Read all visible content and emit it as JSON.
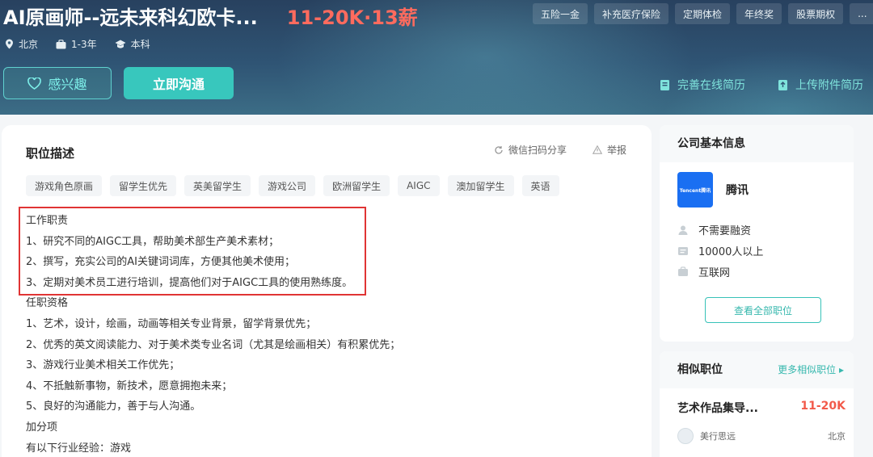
{
  "job": {
    "title": "AI原画师--远未来科幻欧卡...",
    "salary": "11-20K·13薪",
    "city": "北京",
    "experience": "1-3年",
    "education": "本科",
    "benefits": [
      "五险一金",
      "补充医疗保险",
      "定期体检",
      "年终奖",
      "股票期权",
      "..."
    ]
  },
  "actions": {
    "interest_label": "感兴趣",
    "chat_label": "立即沟通",
    "online_resume_label": "完善在线简历",
    "upload_resume_label": "上传附件简历"
  },
  "description": {
    "section_title": "职位描述",
    "share_label": "微信扫码分享",
    "report_label": "举报",
    "tags": [
      "游戏角色原画",
      "留学生优先",
      "英美留学生",
      "游戏公司",
      "欧洲留学生",
      "AIGC",
      "澳加留学生",
      "英语"
    ],
    "lines": [
      "工作职责",
      "1、研究不同的AIGC工具，帮助美术部生产美术素材；",
      "2、撰写，充实公司的AI关键词词库，方便其他美术使用；",
      "3、定期对美术员工进行培训，提高他们对于AIGC工具的使用熟练度。",
      "任职资格",
      "1、艺术，设计，绘画，动画等相关专业背景，留学背景优先；",
      "2、优秀的英文阅读能力、对于美术类专业名词（尤其是绘画相关）有积累优先；",
      "3、游戏行业美术相关工作优先；",
      "4、不抵触新事物，新技术，愿意拥抱未来；",
      "5、良好的沟通能力，善于与人沟通。",
      "加分项",
      "有以下行业经验：游戏"
    ]
  },
  "company": {
    "section_title": "公司基本信息",
    "logo_text": "Tencent腾讯",
    "name": "腾讯",
    "financing": "不需要融资",
    "size": "10000人以上",
    "industry": "互联网",
    "all_jobs_label": "查看全部职位"
  },
  "similar": {
    "section_title": "相似职位",
    "more_label": "更多相似职位 ▸",
    "items": [
      {
        "title": "艺术作品集导...",
        "salary": "11-20K",
        "company": "美行思远",
        "city": "北京"
      }
    ]
  }
}
